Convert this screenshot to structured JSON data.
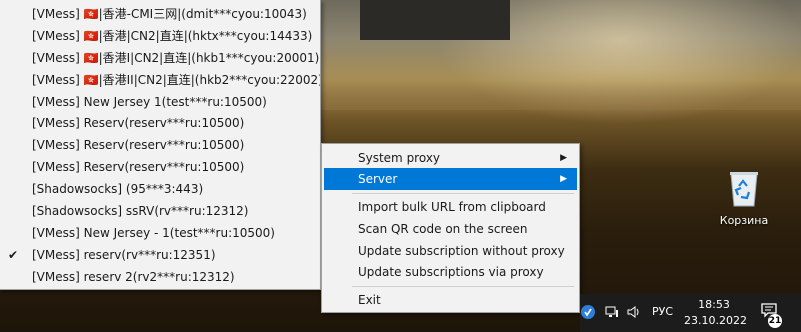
{
  "server_menu": {
    "items": [
      {
        "label": "[VMess] 🇭🇰|香港-CMI三网|(dmit***cyou:10043)",
        "checked": false
      },
      {
        "label": "[VMess] 🇭🇰|香港|CN2|直连|(hktx***cyou:14433)",
        "checked": false
      },
      {
        "label": "[VMess] 🇭🇰|香港I|CN2|直连|(hkb1***cyou:20001)",
        "checked": false
      },
      {
        "label": "[VMess] 🇭🇰|香港II|CN2|直连|(hkb2***cyou:22002)",
        "checked": false
      },
      {
        "label": "[VMess] New Jersey 1(test***ru:10500)",
        "checked": false
      },
      {
        "label": "[VMess] Reserv(reserv***ru:10500)",
        "checked": false
      },
      {
        "label": "[VMess] Reserv(reserv***ru:10500)",
        "checked": false
      },
      {
        "label": "[VMess] Reserv(reserv***ru:10500)",
        "checked": false
      },
      {
        "label": "[Shadowsocks] (95***3:443)",
        "checked": false
      },
      {
        "label": "[Shadowsocks] ssRV(rv***ru:12312)",
        "checked": false
      },
      {
        "label": "[VMess] New Jersey - 1(test***ru:10500)",
        "checked": false
      },
      {
        "label": "[VMess] reserv(rv***ru:12351)",
        "checked": true
      },
      {
        "label": "[VMess] reserv 2(rv2***ru:12312)",
        "checked": false
      }
    ],
    "check_glyph": "✔"
  },
  "context_menu": {
    "system_proxy": "System proxy",
    "server": "Server",
    "import_bulk": "Import bulk URL from clipboard",
    "scan_qr": "Scan QR code on the screen",
    "update_without_proxy": "Update subscription without proxy",
    "update_via_proxy": "Update subscriptions via proxy",
    "exit": "Exit",
    "submenu_arrow": "▶",
    "highlight_color": "#0078d7"
  },
  "desktop": {
    "recycle_bin_label": "Корзина"
  },
  "taskbar": {
    "language": "РУС",
    "time": "18:53",
    "date": "23.10.2022",
    "notification_count": "21"
  }
}
